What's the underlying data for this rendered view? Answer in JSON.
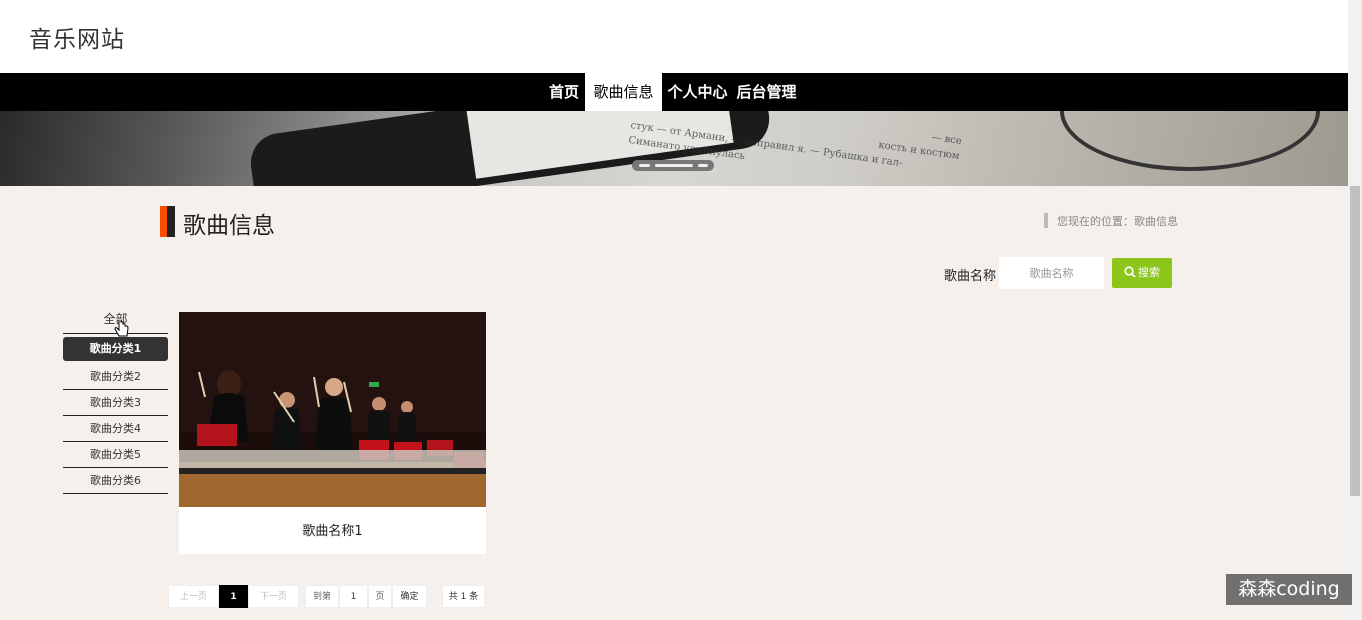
{
  "site": {
    "title": "音乐网站"
  },
  "nav": {
    "items": [
      {
        "label": "首页"
      },
      {
        "label": "歌曲信息"
      },
      {
        "label": "个人中心"
      },
      {
        "label": "后台管理"
      }
    ]
  },
  "banner": {
    "text_lines": [
      "стук — от Армани, — поправил я. — Рубашка и гал-",
      "Симанато улыбнулась",
      "— все",
      "кость и костюм"
    ]
  },
  "section": {
    "title": "歌曲信息",
    "breadcrumb": "您现在的位置：歌曲信息"
  },
  "search": {
    "label": "歌曲名称",
    "placeholder": "歌曲名称",
    "button_label": "搜索",
    "button_color": "#8cc61a"
  },
  "categories": {
    "all_label": "全部",
    "items": [
      {
        "label": "歌曲分类1"
      },
      {
        "label": "歌曲分类2"
      },
      {
        "label": "歌曲分类3"
      },
      {
        "label": "歌曲分类4"
      },
      {
        "label": "歌曲分类5"
      },
      {
        "label": "歌曲分类6"
      }
    ]
  },
  "songs": [
    {
      "name": "歌曲名称1",
      "image_icon": "percussion-ensemble-photo"
    }
  ],
  "pagination": {
    "prev_label": "上一页",
    "current_page": "1",
    "next_label": "下一页",
    "goto_label": "到第",
    "goto_value": "1",
    "page_unit": "页",
    "confirm_label": "确定",
    "total_label": "共 1 条"
  },
  "watermark": "森森coding",
  "colors": {
    "accent": "#ff4d00",
    "nav_bg": "#000000",
    "search_button": "#8cc61a"
  }
}
